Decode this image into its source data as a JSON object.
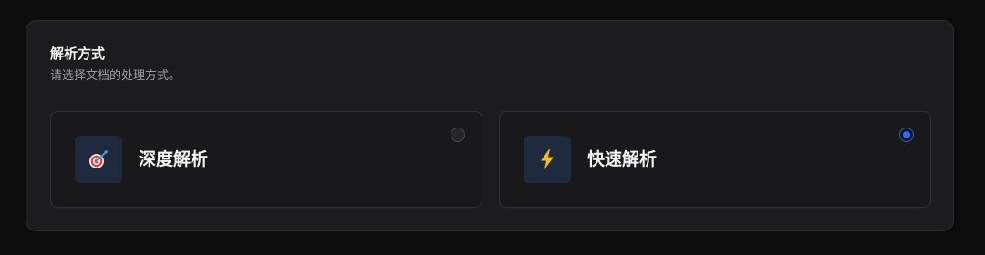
{
  "section": {
    "title": "解析方式",
    "subtitle": "请选择文档的处理方式。"
  },
  "options": [
    {
      "label": "深度解析",
      "icon": "dart-target-icon",
      "selected": false
    },
    {
      "label": "快速解析",
      "icon": "lightning-bolt-icon",
      "selected": true
    }
  ],
  "colors": {
    "background": "#0c0c0d",
    "panel": "#1c1c1e",
    "icon_bg": "#1f2a3e",
    "accent": "#2f6bff"
  }
}
